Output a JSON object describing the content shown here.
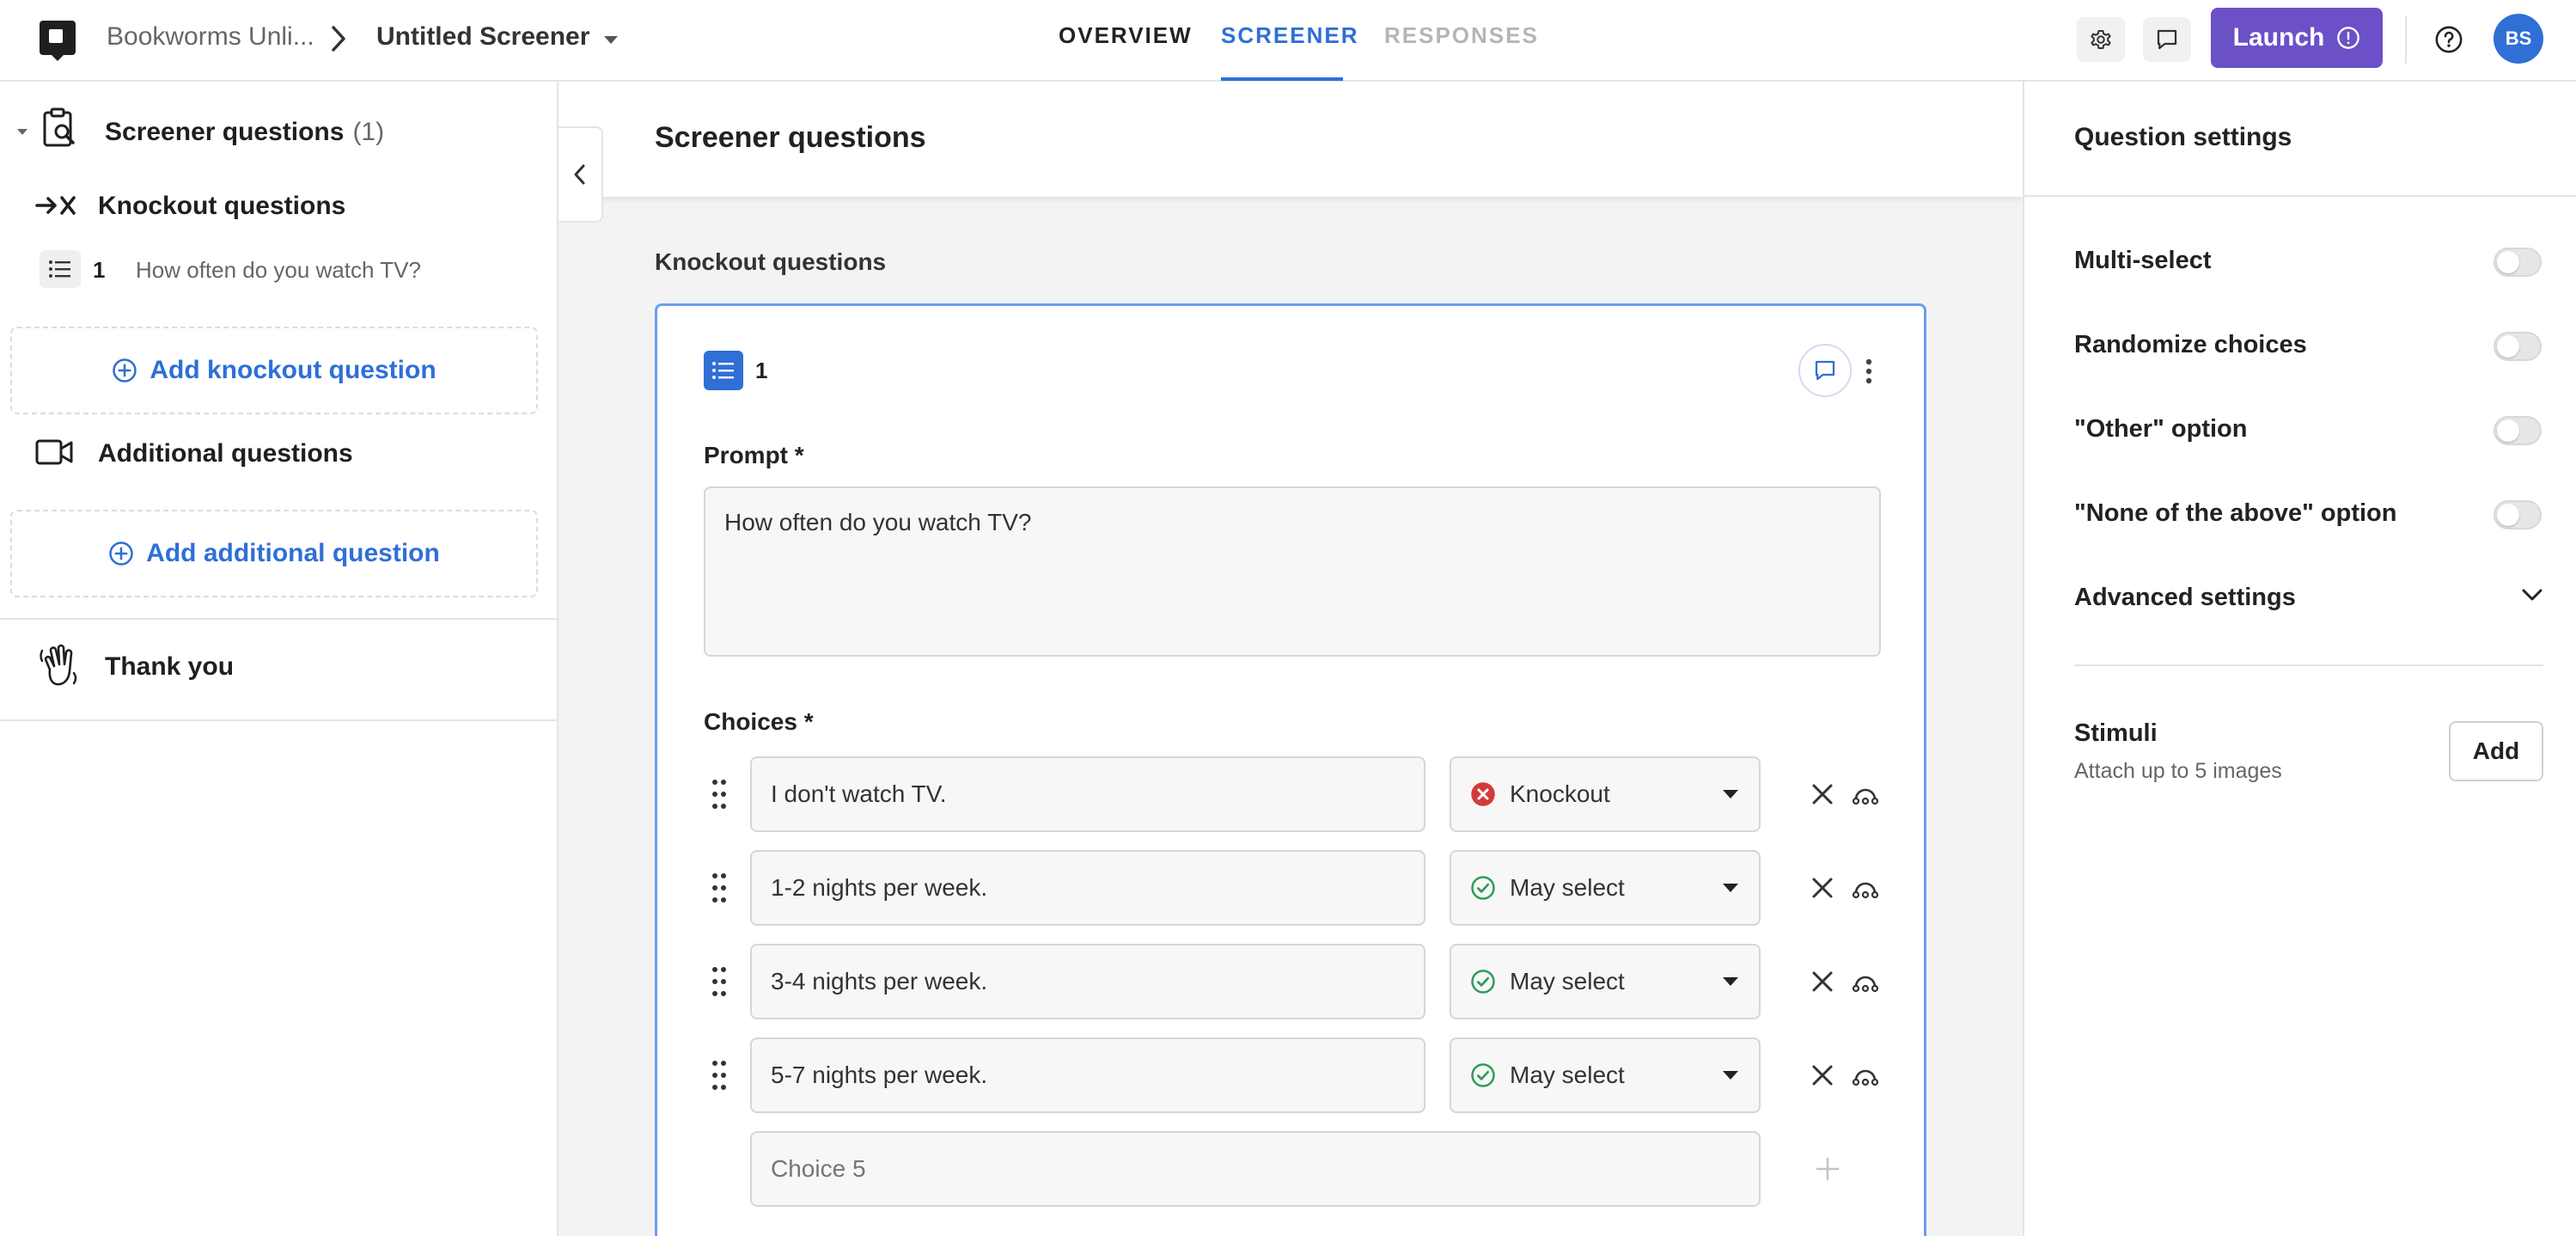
{
  "topbar": {
    "org": "Bookworms Unli...",
    "title": "Untitled Screener",
    "tabs": [
      {
        "label": "OVERVIEW",
        "state": "default"
      },
      {
        "label": "SCREENER",
        "state": "active"
      },
      {
        "label": "RESPONSES",
        "state": "disabled"
      }
    ],
    "launch_label": "Launch",
    "avatar_initials": "BS",
    "icons": [
      "app-logo-icon",
      "chevron-right-icon",
      "caret-down-icon",
      "gear-icon",
      "comment-icon",
      "info-icon",
      "help-icon"
    ]
  },
  "sidebar": {
    "screener_label": "Screener questions",
    "screener_count": "(1)",
    "knockout_label": "Knockout questions",
    "question": {
      "number": "1",
      "text": "How often do you watch TV?"
    },
    "add_knockout_label": "Add knockout question",
    "additional_label": "Additional questions",
    "add_additional_label": "Add additional question",
    "thank_you_label": "Thank you"
  },
  "main": {
    "title": "Screener questions",
    "section_label": "Knockout questions",
    "question_number": "1",
    "prompt_label": "Prompt *",
    "prompt_value": "How often do you watch TV?",
    "choices_label": "Choices *",
    "choices": [
      {
        "text": "I don't watch TV.",
        "rule": "Knockout",
        "rule_icon": "x-circle-icon"
      },
      {
        "text": "1-2 nights per week.",
        "rule": "May select",
        "rule_icon": "check-circle-icon"
      },
      {
        "text": "3-4 nights per week.",
        "rule": "May select",
        "rule_icon": "check-circle-icon"
      },
      {
        "text": "5-7 nights per week.",
        "rule": "May select",
        "rule_icon": "check-circle-icon"
      }
    ],
    "new_choice_placeholder": "Choice 5"
  },
  "settings": {
    "title": "Question settings",
    "toggles": [
      {
        "label": "Multi-select",
        "on": false
      },
      {
        "label": "Randomize choices",
        "on": false
      },
      {
        "label": "\"Other\" option",
        "on": false
      },
      {
        "label": "\"None of the above\" option",
        "on": false
      }
    ],
    "advanced_label": "Advanced settings",
    "stimuli_title": "Stimuli",
    "stimuli_hint": "Attach up to 5 images",
    "stimuli_add_label": "Add"
  },
  "colors": {
    "accent": "#2f6fd6",
    "launch": "#6b50c8",
    "knockout": "#d33a3a",
    "may_select": "#2e9c57",
    "card_border": "#6a9ef0"
  }
}
